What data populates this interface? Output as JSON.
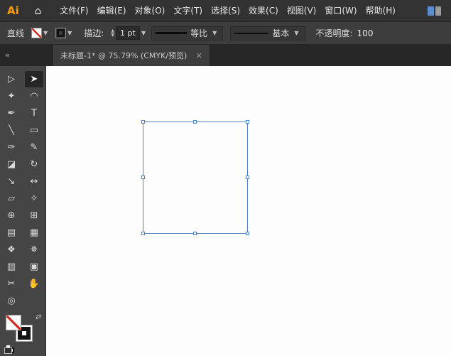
{
  "app": {
    "logo": "Ai"
  },
  "menubar": {
    "items": [
      {
        "name": "menu-file",
        "label": "文件(F)"
      },
      {
        "name": "menu-edit",
        "label": "编辑(E)"
      },
      {
        "name": "menu-object",
        "label": "对象(O)"
      },
      {
        "name": "menu-type",
        "label": "文字(T)"
      },
      {
        "name": "menu-select",
        "label": "选择(S)"
      },
      {
        "name": "menu-effect",
        "label": "效果(C)"
      },
      {
        "name": "menu-view",
        "label": "视图(V)"
      },
      {
        "name": "menu-window",
        "label": "窗口(W)"
      },
      {
        "name": "menu-help",
        "label": "帮助(H)"
      }
    ]
  },
  "controlbar": {
    "object_type": "直线",
    "stroke_label": "描边:",
    "stroke_weight": "1 pt",
    "variable_width_profile": "等比",
    "brush_definition": "基本",
    "opacity_label": "不透明度:",
    "opacity_value": "100"
  },
  "tabbar": {
    "collapse_label": "«",
    "title": "未标题-1* @ 75.79% (CMYK/预览)",
    "close_label": "×"
  },
  "toolbar": {
    "tools": [
      {
        "name": "direct-selection-tool",
        "glyph": "▷"
      },
      {
        "name": "selection-tool",
        "glyph": "➤",
        "active": true
      },
      {
        "name": "magic-wand-tool",
        "glyph": "✦"
      },
      {
        "name": "lasso-tool",
        "glyph": "◠"
      },
      {
        "name": "pen-tool",
        "glyph": "✒"
      },
      {
        "name": "type-tool",
        "glyph": "T"
      },
      {
        "name": "line-segment-tool",
        "glyph": "╲"
      },
      {
        "name": "rectangle-tool",
        "glyph": "▭"
      },
      {
        "name": "paintbrush-tool",
        "glyph": "✑"
      },
      {
        "name": "pencil-tool",
        "glyph": "✎"
      },
      {
        "name": "eraser-tool",
        "glyph": "◪"
      },
      {
        "name": "rotate-tool",
        "glyph": "↻"
      },
      {
        "name": "scale-tool",
        "glyph": "↘"
      },
      {
        "name": "width-tool",
        "glyph": "↔"
      },
      {
        "name": "free-transform-tool",
        "glyph": "▱"
      },
      {
        "name": "eyedropper-tool",
        "glyph": "✧"
      },
      {
        "name": "shape-builder-tool",
        "glyph": "⊕"
      },
      {
        "name": "perspective-grid-tool",
        "glyph": "⊞"
      },
      {
        "name": "gradient-tool",
        "glyph": "▤"
      },
      {
        "name": "mesh-tool",
        "glyph": "▦"
      },
      {
        "name": "blend-tool",
        "glyph": "❖"
      },
      {
        "name": "symbol-sprayer-tool",
        "glyph": "✵"
      },
      {
        "name": "column-graph-tool",
        "glyph": "▥"
      },
      {
        "name": "artboard-tool",
        "glyph": "▣"
      },
      {
        "name": "slice-tool",
        "glyph": "✂"
      },
      {
        "name": "hand-tool",
        "glyph": "✋"
      },
      {
        "name": "zoom-tool",
        "glyph": "◎"
      }
    ],
    "fill_swatch": "none",
    "stroke_swatch": "black"
  },
  "colors": {
    "selection_blue": "#4f82c2",
    "none_slash_red": "#d22a1e",
    "logo_orange": "#ff9a00"
  }
}
